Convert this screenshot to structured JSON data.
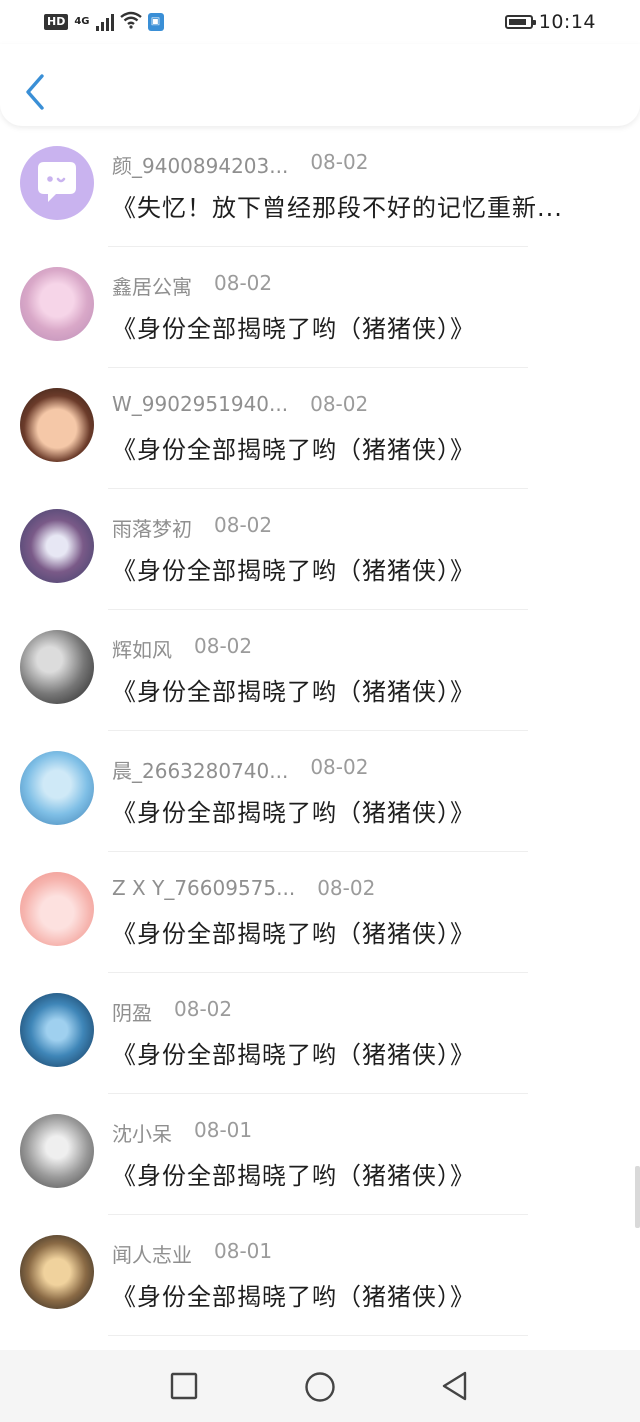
{
  "status_bar": {
    "hd": "HD",
    "network": "4G",
    "time": "10:14",
    "battery_level": 0.85
  },
  "header": {
    "back_icon": "chevron-left-icon",
    "accent": "#3a8fd6"
  },
  "list": {
    "items": [
      {
        "name": "颜_9400894203...",
        "date": "08-02",
        "title": "《失忆！放下曾经那段不好的记忆重新..."
      },
      {
        "name": "鑫居公寓",
        "date": "08-02",
        "title": "《身份全部揭晓了哟（猪猪侠）》"
      },
      {
        "name": "W_9902951940...",
        "date": "08-02",
        "title": "《身份全部揭晓了哟（猪猪侠）》"
      },
      {
        "name": "雨落梦初",
        "date": "08-02",
        "title": "《身份全部揭晓了哟（猪猪侠）》"
      },
      {
        "name": "辉如风",
        "date": "08-02",
        "title": "《身份全部揭晓了哟（猪猪侠）》"
      },
      {
        "name": "晨_2663280740...",
        "date": "08-02",
        "title": "《身份全部揭晓了哟（猪猪侠）》"
      },
      {
        "name": "Z X Y_76609575...",
        "date": "08-02",
        "title": "《身份全部揭晓了哟（猪猪侠）》"
      },
      {
        "name": "阴盈",
        "date": "08-02",
        "title": "《身份全部揭晓了哟（猪猪侠）》"
      },
      {
        "name": "沈小呆",
        "date": "08-01",
        "title": "《身份全部揭晓了哟（猪猪侠）》"
      },
      {
        "name": "闻人志业",
        "date": "08-01",
        "title": "《身份全部揭晓了哟（猪猪侠）》"
      }
    ]
  },
  "nav_bar": {
    "recent_icon": "square-recent-apps-icon",
    "home_icon": "circle-home-icon",
    "back_icon": "triangle-back-icon"
  }
}
